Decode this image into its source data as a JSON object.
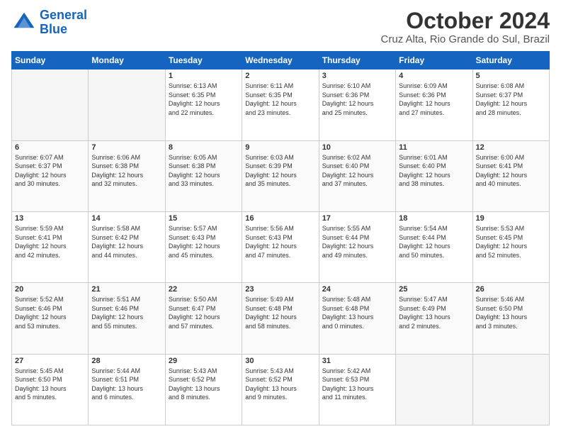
{
  "header": {
    "logo_line1": "General",
    "logo_line2": "Blue",
    "title": "October 2024",
    "subtitle": "Cruz Alta, Rio Grande do Sul, Brazil"
  },
  "days_of_week": [
    "Sunday",
    "Monday",
    "Tuesday",
    "Wednesday",
    "Thursday",
    "Friday",
    "Saturday"
  ],
  "weeks": [
    [
      {
        "day": "",
        "info": ""
      },
      {
        "day": "",
        "info": ""
      },
      {
        "day": "1",
        "info": "Sunrise: 6:13 AM\nSunset: 6:35 PM\nDaylight: 12 hours\nand 22 minutes."
      },
      {
        "day": "2",
        "info": "Sunrise: 6:11 AM\nSunset: 6:35 PM\nDaylight: 12 hours\nand 23 minutes."
      },
      {
        "day": "3",
        "info": "Sunrise: 6:10 AM\nSunset: 6:36 PM\nDaylight: 12 hours\nand 25 minutes."
      },
      {
        "day": "4",
        "info": "Sunrise: 6:09 AM\nSunset: 6:36 PM\nDaylight: 12 hours\nand 27 minutes."
      },
      {
        "day": "5",
        "info": "Sunrise: 6:08 AM\nSunset: 6:37 PM\nDaylight: 12 hours\nand 28 minutes."
      }
    ],
    [
      {
        "day": "6",
        "info": "Sunrise: 6:07 AM\nSunset: 6:37 PM\nDaylight: 12 hours\nand 30 minutes."
      },
      {
        "day": "7",
        "info": "Sunrise: 6:06 AM\nSunset: 6:38 PM\nDaylight: 12 hours\nand 32 minutes."
      },
      {
        "day": "8",
        "info": "Sunrise: 6:05 AM\nSunset: 6:38 PM\nDaylight: 12 hours\nand 33 minutes."
      },
      {
        "day": "9",
        "info": "Sunrise: 6:03 AM\nSunset: 6:39 PM\nDaylight: 12 hours\nand 35 minutes."
      },
      {
        "day": "10",
        "info": "Sunrise: 6:02 AM\nSunset: 6:40 PM\nDaylight: 12 hours\nand 37 minutes."
      },
      {
        "day": "11",
        "info": "Sunrise: 6:01 AM\nSunset: 6:40 PM\nDaylight: 12 hours\nand 38 minutes."
      },
      {
        "day": "12",
        "info": "Sunrise: 6:00 AM\nSunset: 6:41 PM\nDaylight: 12 hours\nand 40 minutes."
      }
    ],
    [
      {
        "day": "13",
        "info": "Sunrise: 5:59 AM\nSunset: 6:41 PM\nDaylight: 12 hours\nand 42 minutes."
      },
      {
        "day": "14",
        "info": "Sunrise: 5:58 AM\nSunset: 6:42 PM\nDaylight: 12 hours\nand 44 minutes."
      },
      {
        "day": "15",
        "info": "Sunrise: 5:57 AM\nSunset: 6:43 PM\nDaylight: 12 hours\nand 45 minutes."
      },
      {
        "day": "16",
        "info": "Sunrise: 5:56 AM\nSunset: 6:43 PM\nDaylight: 12 hours\nand 47 minutes."
      },
      {
        "day": "17",
        "info": "Sunrise: 5:55 AM\nSunset: 6:44 PM\nDaylight: 12 hours\nand 49 minutes."
      },
      {
        "day": "18",
        "info": "Sunrise: 5:54 AM\nSunset: 6:44 PM\nDaylight: 12 hours\nand 50 minutes."
      },
      {
        "day": "19",
        "info": "Sunrise: 5:53 AM\nSunset: 6:45 PM\nDaylight: 12 hours\nand 52 minutes."
      }
    ],
    [
      {
        "day": "20",
        "info": "Sunrise: 5:52 AM\nSunset: 6:46 PM\nDaylight: 12 hours\nand 53 minutes."
      },
      {
        "day": "21",
        "info": "Sunrise: 5:51 AM\nSunset: 6:46 PM\nDaylight: 12 hours\nand 55 minutes."
      },
      {
        "day": "22",
        "info": "Sunrise: 5:50 AM\nSunset: 6:47 PM\nDaylight: 12 hours\nand 57 minutes."
      },
      {
        "day": "23",
        "info": "Sunrise: 5:49 AM\nSunset: 6:48 PM\nDaylight: 12 hours\nand 58 minutes."
      },
      {
        "day": "24",
        "info": "Sunrise: 5:48 AM\nSunset: 6:48 PM\nDaylight: 13 hours\nand 0 minutes."
      },
      {
        "day": "25",
        "info": "Sunrise: 5:47 AM\nSunset: 6:49 PM\nDaylight: 13 hours\nand 2 minutes."
      },
      {
        "day": "26",
        "info": "Sunrise: 5:46 AM\nSunset: 6:50 PM\nDaylight: 13 hours\nand 3 minutes."
      }
    ],
    [
      {
        "day": "27",
        "info": "Sunrise: 5:45 AM\nSunset: 6:50 PM\nDaylight: 13 hours\nand 5 minutes."
      },
      {
        "day": "28",
        "info": "Sunrise: 5:44 AM\nSunset: 6:51 PM\nDaylight: 13 hours\nand 6 minutes."
      },
      {
        "day": "29",
        "info": "Sunrise: 5:43 AM\nSunset: 6:52 PM\nDaylight: 13 hours\nand 8 minutes."
      },
      {
        "day": "30",
        "info": "Sunrise: 5:43 AM\nSunset: 6:52 PM\nDaylight: 13 hours\nand 9 minutes."
      },
      {
        "day": "31",
        "info": "Sunrise: 5:42 AM\nSunset: 6:53 PM\nDaylight: 13 hours\nand 11 minutes."
      },
      {
        "day": "",
        "info": ""
      },
      {
        "day": "",
        "info": ""
      }
    ]
  ]
}
